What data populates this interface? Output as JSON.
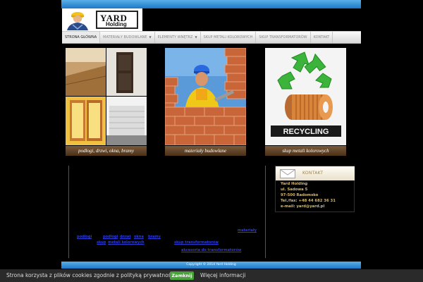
{
  "logo": {
    "brand_line1": "YARD",
    "brand_line2": "Holding",
    "icon": "construction-worker-icon"
  },
  "nav": {
    "items": [
      {
        "label": "STRONA GŁÓWNA",
        "active": true,
        "dropdown": false
      },
      {
        "label": "MATERIAŁY BUDOWLANE",
        "active": false,
        "dropdown": true
      },
      {
        "label": "ELEMENTY WNĘTRZ",
        "active": false,
        "dropdown": true
      },
      {
        "label": "SKUP METALI KOLOROWYCH",
        "active": false,
        "dropdown": false
      },
      {
        "label": "SKUP TRANSFORMATORÓW",
        "active": false,
        "dropdown": false
      },
      {
        "label": "KONTAKT",
        "active": false,
        "dropdown": false
      }
    ]
  },
  "tiles": [
    {
      "caption": "podłogi, drzwi, okna, bramy",
      "image": "doors-floors-collage"
    },
    {
      "caption": "materiały budowlane",
      "image": "bricklayer-photo"
    },
    {
      "caption": "skup metali kolorowych",
      "image": "recycling-copper-photo"
    }
  ],
  "links": {
    "materialy": "materiały",
    "row1": [
      "podłogi",
      "podłogi",
      "drzwi",
      "okna",
      "bramy"
    ],
    "row2a": "skup",
    "row2b": "metali kolorowych",
    "row2c": "skup transformatorów",
    "row3": "akcesoria do transformatorów"
  },
  "contact": {
    "title": "KONTAKT",
    "icon": "envelope-icon",
    "lines": [
      "Yard Holding",
      "ul. Sadowa 5",
      "97-500 Radomsko",
      "Tel./fax: +48 44 682 36 31",
      "e-mail: yard@yard.pl"
    ]
  },
  "footer": {
    "copyright": "Copyright © 2014 Yard Holding"
  },
  "cookie_bar": {
    "message": "Strona korzysta z plików cookies zgodnie z polityką prywatności.",
    "accept_label": "Zamknij",
    "more_label": "Więcej informacji"
  },
  "colors": {
    "accent_blue": "#1e78c8",
    "caption_brown": "#5a3c20",
    "contact_gold": "#d7b96a",
    "cookie_accept": "#4aa03a"
  }
}
